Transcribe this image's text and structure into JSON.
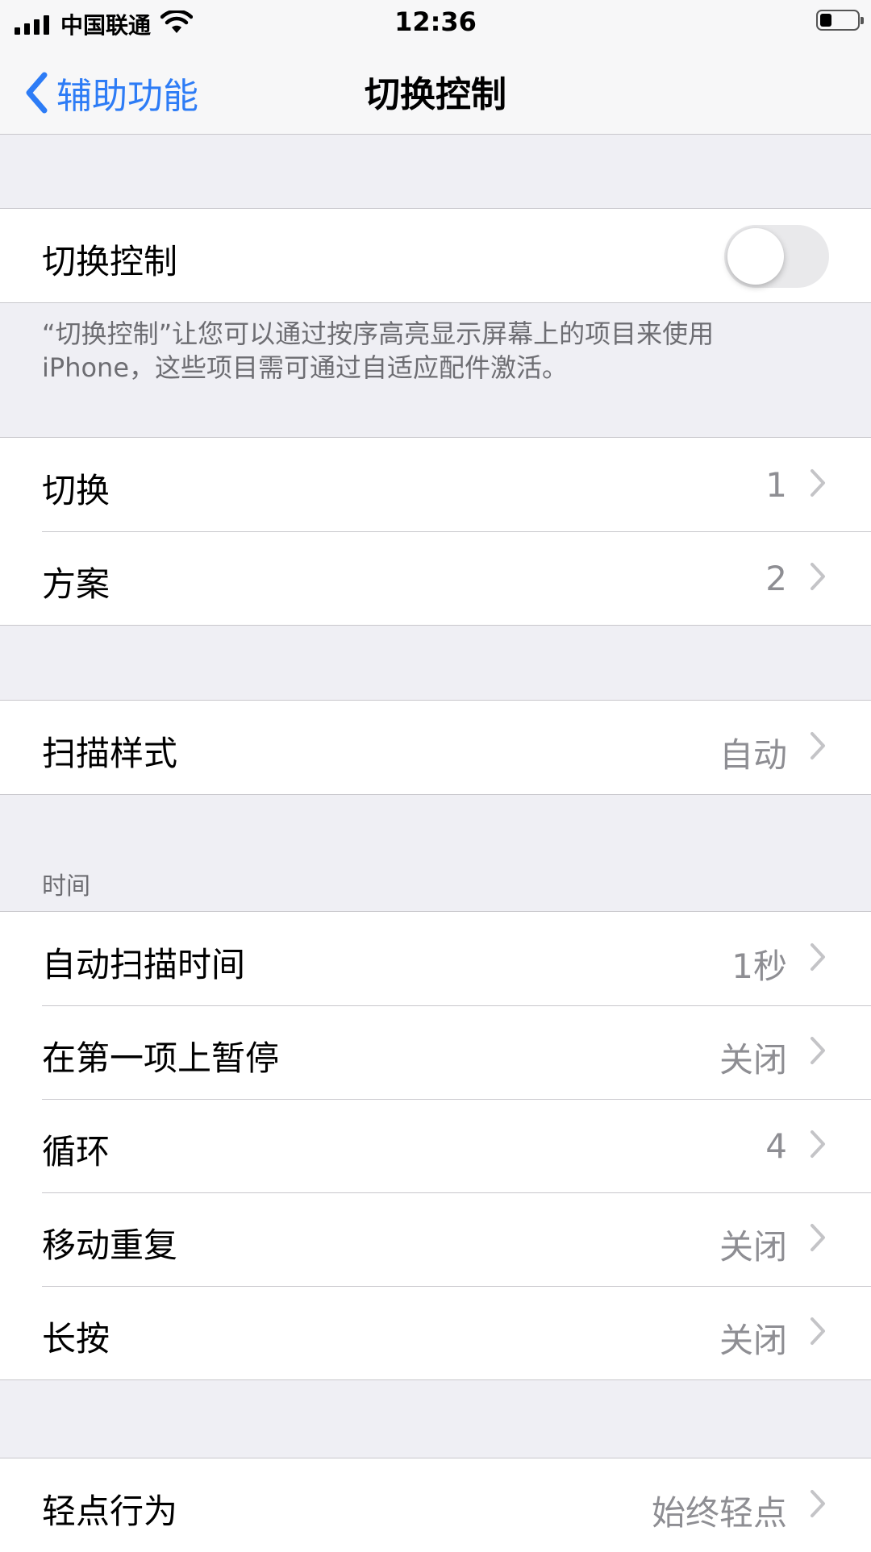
{
  "status_bar": {
    "carrier": "中国联通",
    "time": "12:36"
  },
  "nav": {
    "back_label": "辅助功能",
    "title": "切换控制"
  },
  "switch_control": {
    "label": "切换控制",
    "toggle_on": false,
    "footer": "“切换控制”让您可以通过按序高亮显示屏幕上的项目来使用iPhone，这些项目需可通过自适应配件激活。"
  },
  "group_switches": [
    {
      "label": "切换",
      "value": "1"
    },
    {
      "label": "方案",
      "value": "2"
    }
  ],
  "group_scan": [
    {
      "label": "扫描样式",
      "value": "自动"
    }
  ],
  "timing": {
    "header": "时间",
    "items": [
      {
        "label": "自动扫描时间",
        "value": "1秒"
      },
      {
        "label": "在第一项上暂停",
        "value": "关闭"
      },
      {
        "label": "循环",
        "value": "4"
      },
      {
        "label": "移动重复",
        "value": "关闭"
      },
      {
        "label": "长按",
        "value": "关闭"
      }
    ]
  },
  "group_tap": [
    {
      "label": "轻点行为",
      "value": "始终轻点"
    }
  ],
  "colors": {
    "accent": "#2d7cf6",
    "background": "#efeff4",
    "separator": "#c8c7cc",
    "secondary_text": "#8e8e93"
  }
}
